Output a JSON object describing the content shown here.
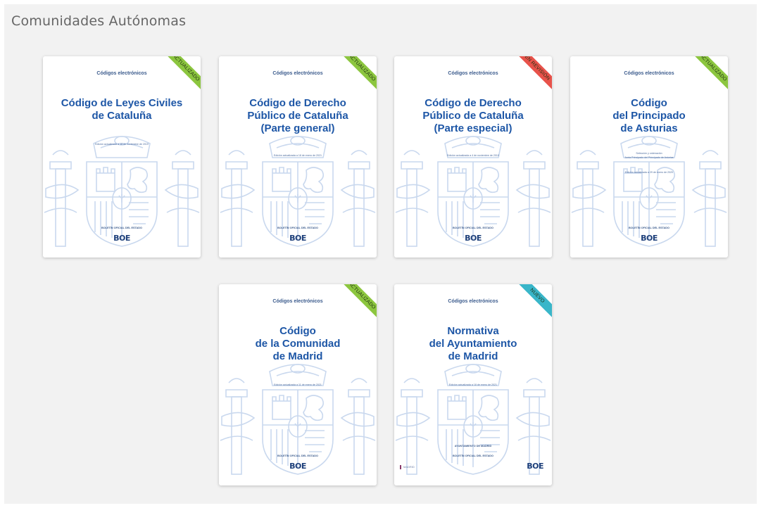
{
  "section": {
    "title": "Comunidades Autónomas"
  },
  "colors": {
    "ribbon_updated": "#8cc63f",
    "ribbon_review": "#e8524a",
    "ribbon_new": "#39b6c9",
    "title_blue": "#1d56a6",
    "crest_blue": "#c7d6ec"
  },
  "cards": [
    {
      "series": "Códigos electrónicos",
      "title_lines": [
        "Código de Leyes Civiles",
        "de Cataluña"
      ],
      "edition": "Edición actualizada a 18 de noviembre de 2019",
      "publisher": "BOLETÍN OFICIAL DEL ESTADO",
      "logo": "BOE",
      "badge": "ACTUALIZADO",
      "badge_color": "#8cc63f"
    },
    {
      "series": "Códigos electrónicos",
      "title_lines": [
        "Código de Derecho",
        "Público de Cataluña",
        "(Parte general)"
      ],
      "edition": "Edición actualizada a 18 de enero de 2021",
      "publisher": "BOLETÍN OFICIAL DEL ESTADO",
      "logo": "BOE",
      "badge": "ACTUALIZADO",
      "badge_color": "#8cc63f"
    },
    {
      "series": "Códigos electrónicos",
      "title_lines": [
        "Código de Derecho",
        "Público de Cataluña",
        "(Parte especial)"
      ],
      "edition": "Edición actualizada a 4 de noviembre de 2019",
      "publisher": "BOLETÍN OFICIAL DEL ESTADO",
      "logo": "BOE",
      "badge": "EN REVISIÓN",
      "badge_color": "#e8524a"
    },
    {
      "series": "Códigos electrónicos",
      "title_lines": [
        "Código",
        "del Principado",
        "de Asturias"
      ],
      "subline_1": "Selección y ordenación",
      "subline_2": "Junta Principado del Principado de Asturias",
      "edition": "Edición actualizada a 29 de enero de 2020",
      "publisher": "BOLETÍN OFICIAL DEL ESTADO",
      "logo": "BOE",
      "badge": "ACTUALIZADO",
      "badge_color": "#8cc63f"
    },
    {
      "series": "Códigos electrónicos",
      "title_lines": [
        "Código",
        "de la Comunidad",
        "de Madrid"
      ],
      "edition": "Edición actualizada a 11 de enero de 2021",
      "publisher": "BOLETÍN OFICIAL DEL ESTADO",
      "logo": "BOE",
      "badge": "ACTUALIZADO",
      "badge_color": "#8cc63f"
    },
    {
      "series": "Códigos electrónicos",
      "title_lines": [
        "Normativa",
        "del Ayuntamiento",
        "de Madrid"
      ],
      "edition": "Edición actualizada a 18 de enero de 2021",
      "co_publisher": "AYUNTAMIENTO DE MADRID",
      "publisher": "BOLETÍN OFICIAL DEL ESTADO",
      "logo": "BOE",
      "left_mark": "MADRID",
      "badge": "NUEVO",
      "badge_color": "#39b6c9"
    }
  ]
}
